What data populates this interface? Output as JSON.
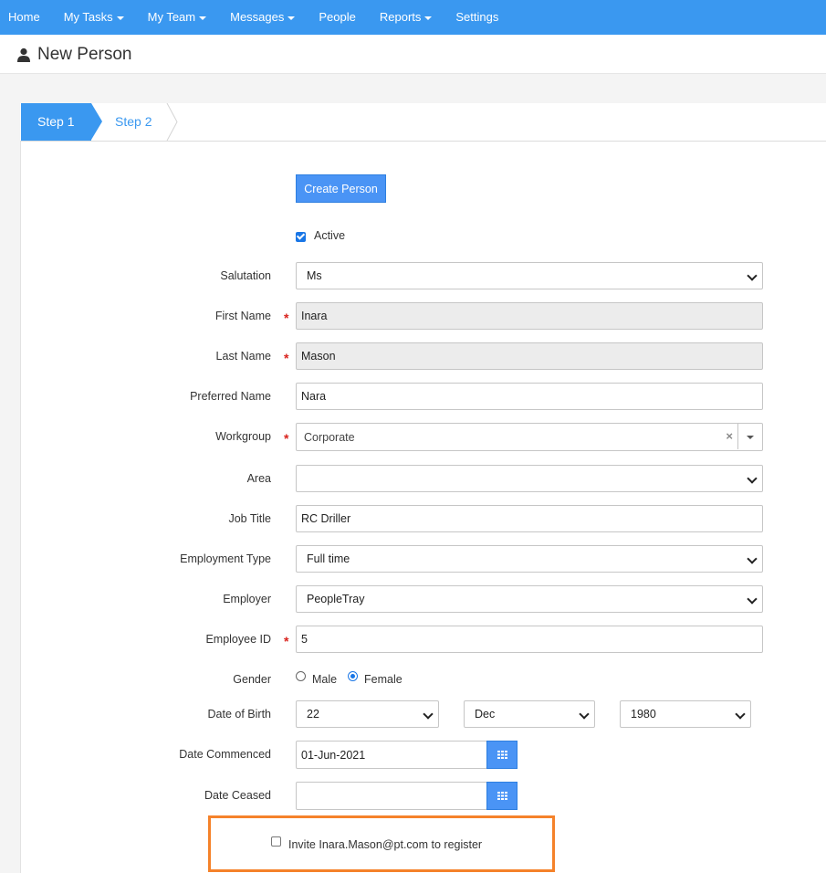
{
  "nav": {
    "items": [
      {
        "label": "Home",
        "dropdown": false
      },
      {
        "label": "My Tasks",
        "dropdown": true
      },
      {
        "label": "My Team",
        "dropdown": true
      },
      {
        "label": "Messages",
        "dropdown": true
      },
      {
        "label": "People",
        "dropdown": false
      },
      {
        "label": "Reports",
        "dropdown": true
      },
      {
        "label": "Settings",
        "dropdown": false
      }
    ]
  },
  "header": {
    "title": "New Person",
    "icon": "user-icon"
  },
  "wizard": {
    "step1": "Step 1",
    "step2": "Step 2"
  },
  "form": {
    "create_button": "Create Person",
    "active_label": "Active",
    "active_checked": true,
    "salutation": {
      "label": "Salutation",
      "value": "Ms"
    },
    "first_name": {
      "label": "First Name",
      "value": "Inara",
      "required": true
    },
    "last_name": {
      "label": "Last Name",
      "value": "Mason",
      "required": true
    },
    "preferred_name": {
      "label": "Preferred Name",
      "value": "Nara"
    },
    "workgroup": {
      "label": "Workgroup",
      "value": "Corporate",
      "required": true,
      "clear": "×"
    },
    "area": {
      "label": "Area",
      "value": ""
    },
    "job_title": {
      "label": "Job Title",
      "value": "RC Driller"
    },
    "employment_type": {
      "label": "Employment Type",
      "value": "Full time"
    },
    "employer": {
      "label": "Employer",
      "value": "PeopleTray"
    },
    "employee_id": {
      "label": "Employee ID",
      "value": "5",
      "required": true
    },
    "gender": {
      "label": "Gender",
      "options": [
        "Male",
        "Female"
      ],
      "selected": "Female"
    },
    "dob": {
      "label": "Date of Birth",
      "day": "22",
      "month": "Dec",
      "year": "1980"
    },
    "date_commenced": {
      "label": "Date Commenced",
      "value": "01-Jun-2021"
    },
    "date_ceased": {
      "label": "Date Ceased",
      "value": ""
    },
    "invite": {
      "label": "Invite Inara.Mason@pt.com to register",
      "checked": false
    }
  },
  "required_marker": "*",
  "colors": {
    "nav": "#3a98f0",
    "primary_button": "#4a94f5",
    "required": "#d9231d",
    "highlight": "#f5822a"
  }
}
